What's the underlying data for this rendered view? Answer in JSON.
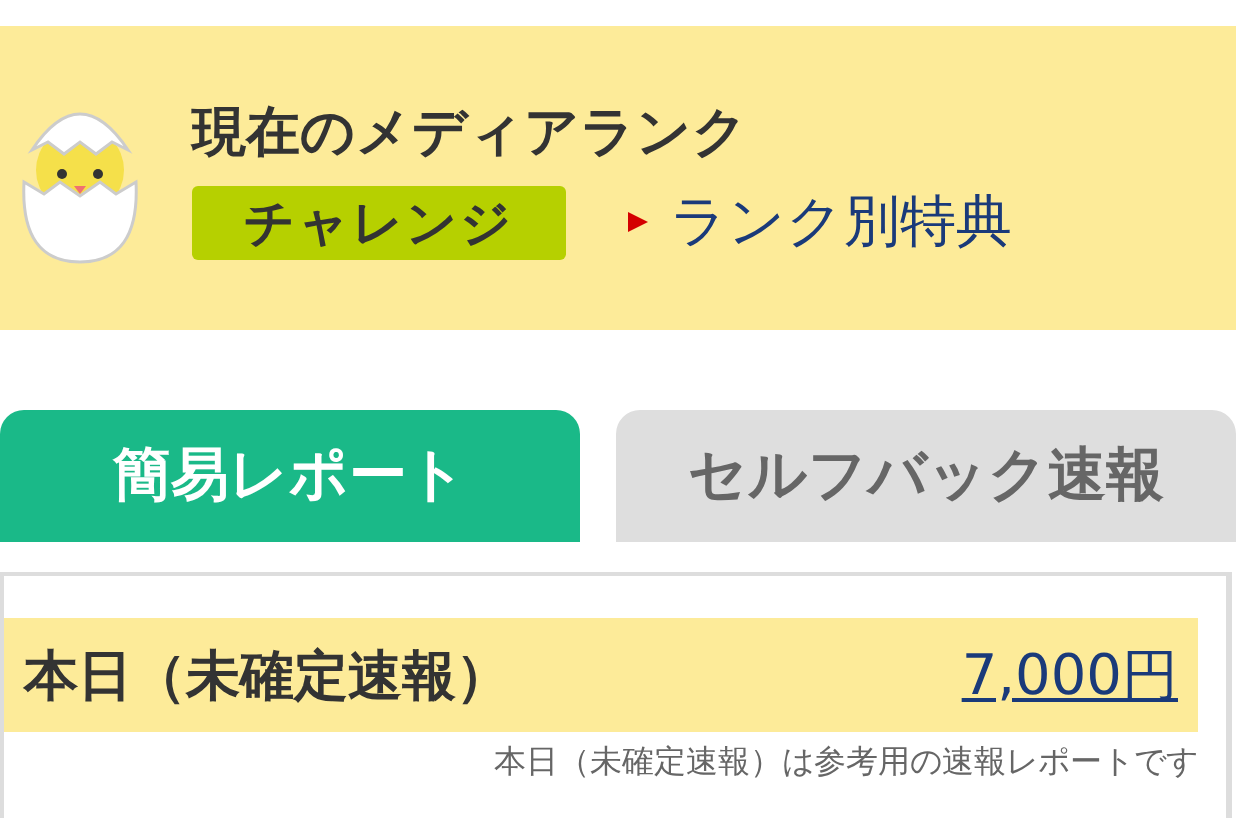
{
  "rank": {
    "title": "現在のメディアランク",
    "badge": "チャレンジ",
    "link": "ランク別特典"
  },
  "tabs": [
    {
      "label": "簡易レポート",
      "selected": true
    },
    {
      "label": "セルフバック速報",
      "selected": false
    }
  ],
  "report": {
    "label": "本日（未確定速報）",
    "amount": "7,000円",
    "note": "本日（未確定速報）は参考用の速報レポートです"
  }
}
